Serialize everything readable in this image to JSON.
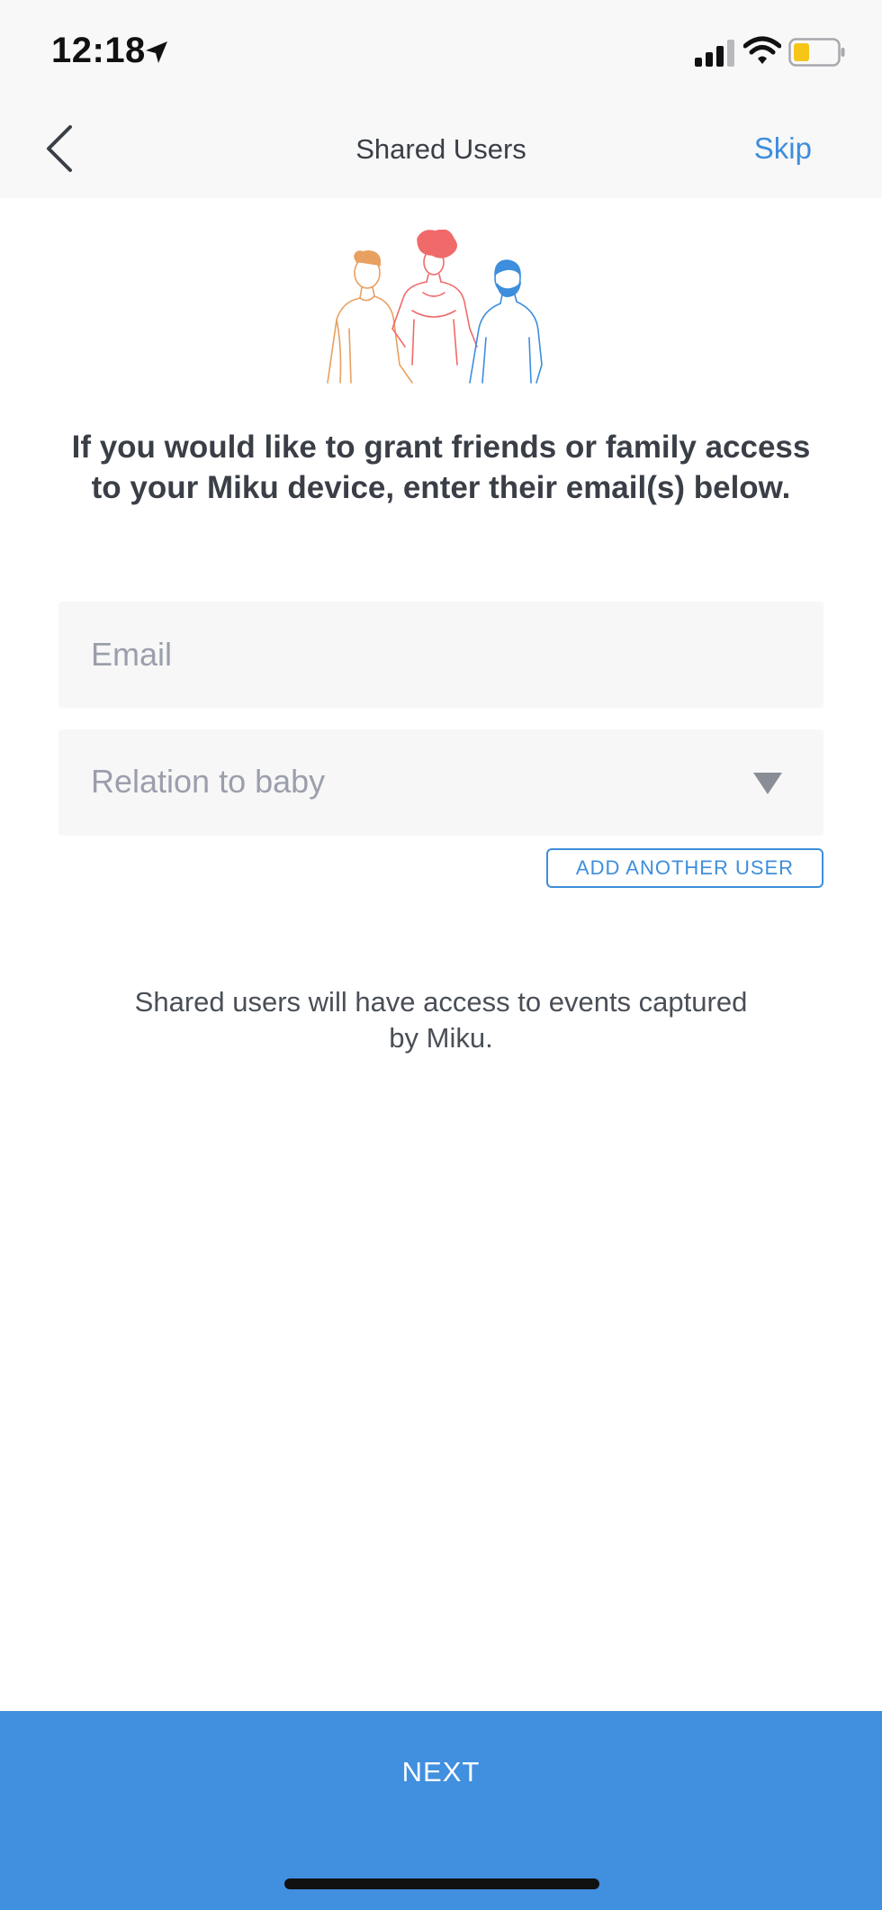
{
  "status_bar": {
    "time": "12:18",
    "location_icon": "location-arrow-icon",
    "signal_icon": "cellular-signal-icon",
    "wifi_icon": "wifi-icon",
    "battery_icon": "battery-low-icon",
    "battery_level_fraction": 0.3,
    "battery_color": "#f5c518"
  },
  "nav": {
    "back_icon": "chevron-left-icon",
    "title": "Shared Users",
    "skip_label": "Skip"
  },
  "illustration": {
    "name": "people-group-illustration",
    "colors": [
      "#e8a060",
      "#f06a6a",
      "#3d8edc"
    ]
  },
  "intro_text": "If you would like to grant friends or family access to your Miku device, enter their email(s) below.",
  "form": {
    "email_placeholder": "Email",
    "email_value": "",
    "relation_placeholder": "Relation to baby",
    "dropdown_icon": "triangle-down-icon",
    "add_user_label": "ADD ANOTHER USER"
  },
  "info_text": "Shared users will have access to events captured by Miku.",
  "footer": {
    "next_label": "NEXT"
  },
  "colors": {
    "accent": "#3d8edc",
    "next_button_bg": "#418fdf",
    "input_bg": "#f7f7f8",
    "text": "#3a3f47",
    "placeholder": "#9b9fab"
  }
}
